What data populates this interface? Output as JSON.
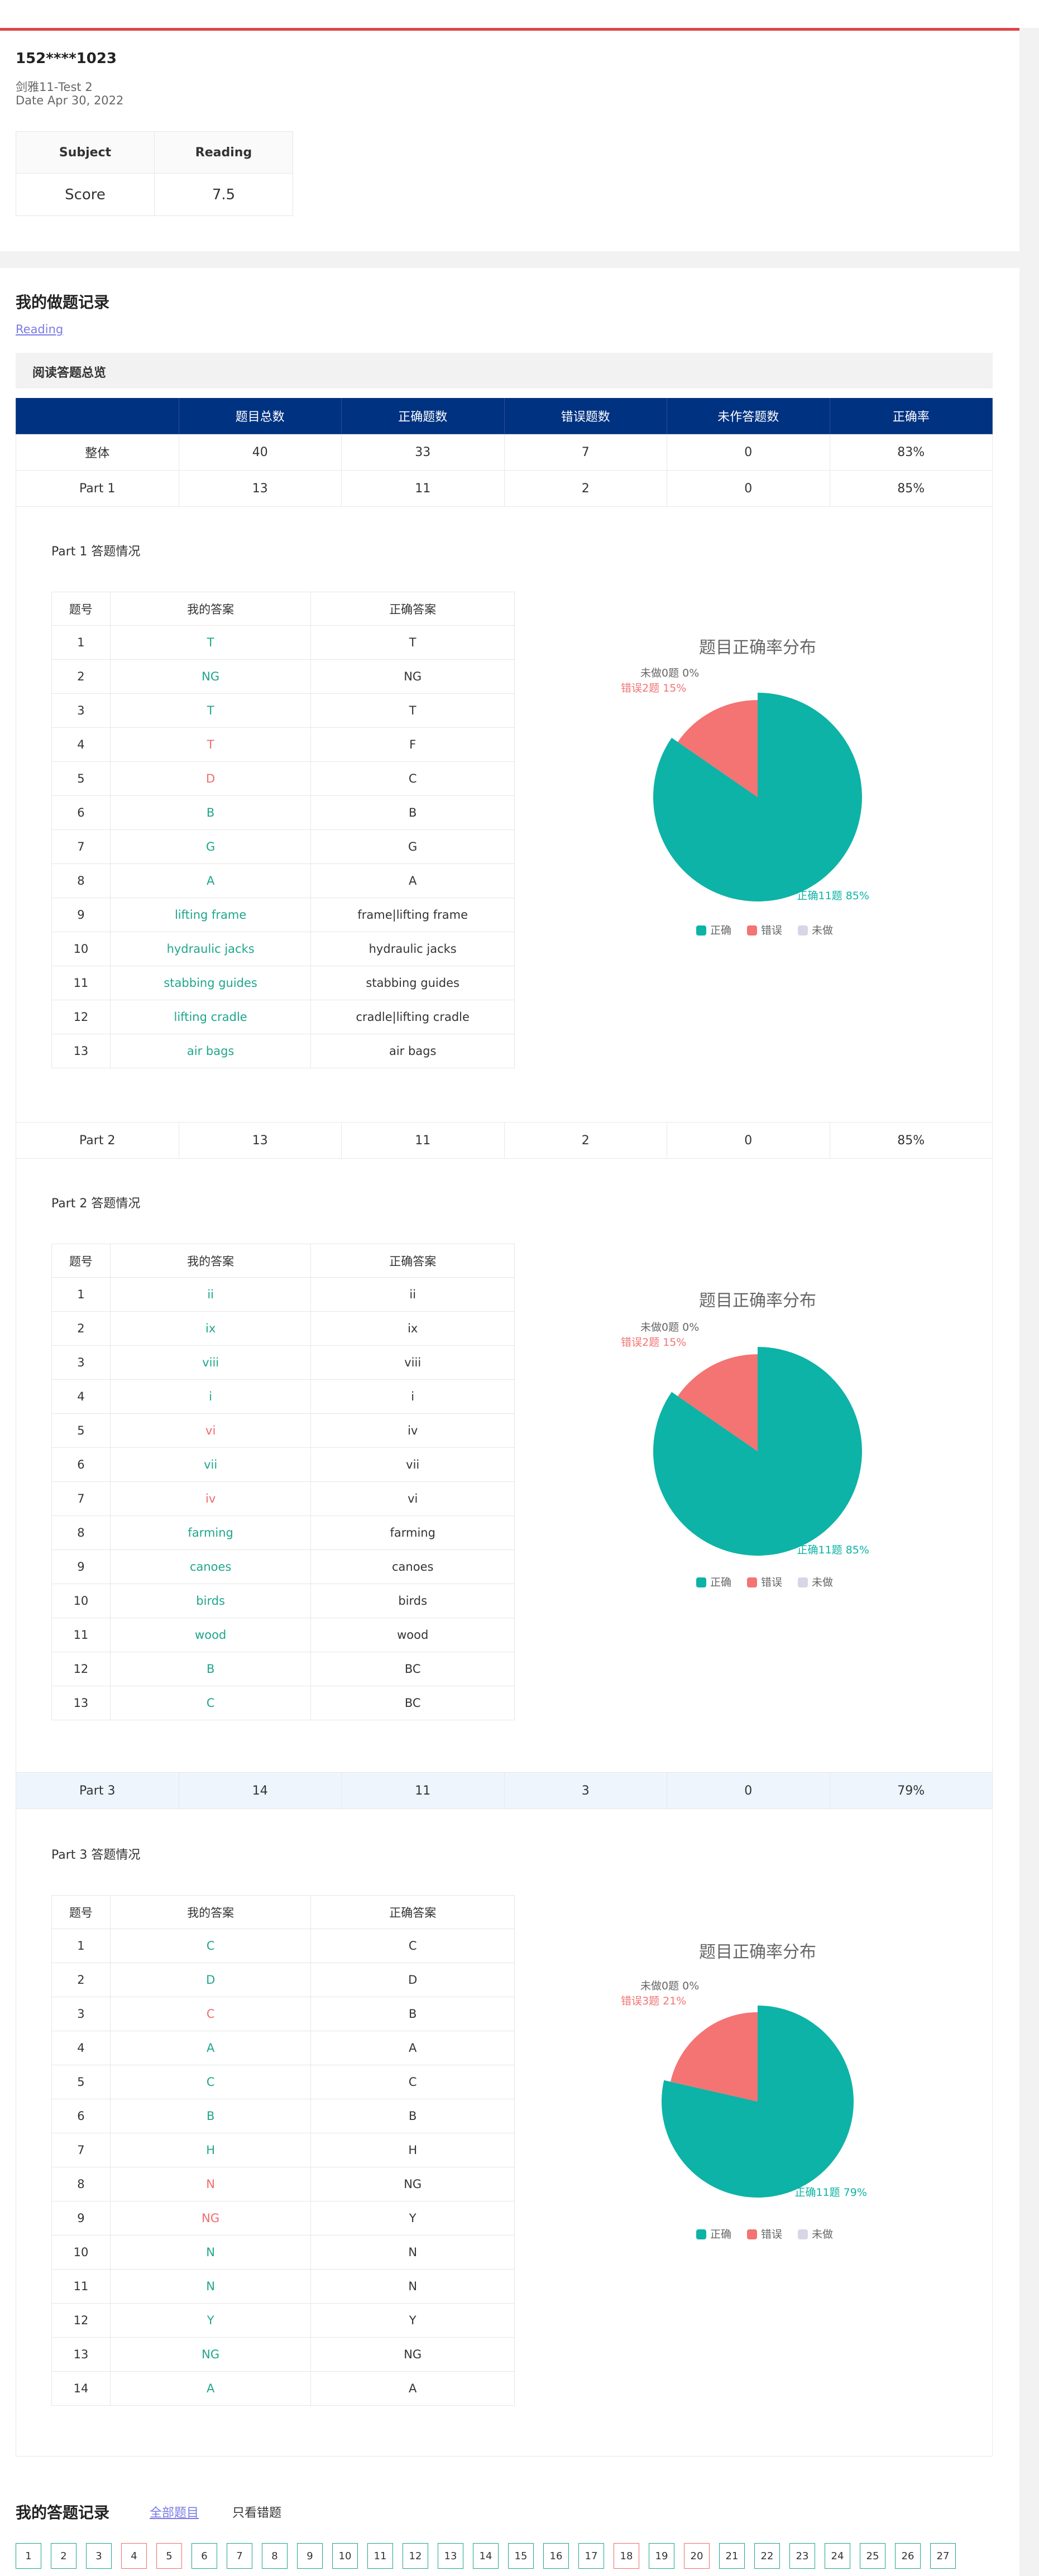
{
  "header": {
    "user": "152****1023",
    "test_name": "剑雅11-Test 2",
    "date": "Date Apr 30, 2022",
    "score_table": {
      "col1_header": "Subject",
      "col2_header": "Reading",
      "row_label": "Score",
      "score": "7.5"
    }
  },
  "records": {
    "title": "我的做题记录",
    "subject_link": "Reading",
    "overview_title": "阅读答题总览",
    "columns": [
      "",
      "题目总数",
      "正确题数",
      "错误题数",
      "未作答题数",
      "正确率"
    ],
    "overall": [
      "整体",
      "40",
      "33",
      "7",
      "0",
      "83%"
    ],
    "parts": [
      {
        "summary": [
          "Part 1",
          "13",
          "11",
          "2",
          "0",
          "85%"
        ],
        "detail_title": "Part 1 答题情况",
        "table_headers": [
          "题号",
          "我的答案",
          "正确答案"
        ],
        "rows": [
          {
            "no": "1",
            "mine": "T",
            "correct": "T",
            "ok": true
          },
          {
            "no": "2",
            "mine": "NG",
            "correct": "NG",
            "ok": true
          },
          {
            "no": "3",
            "mine": "T",
            "correct": "T",
            "ok": true
          },
          {
            "no": "4",
            "mine": "T",
            "correct": "F",
            "ok": false
          },
          {
            "no": "5",
            "mine": "D",
            "correct": "C",
            "ok": false
          },
          {
            "no": "6",
            "mine": "B",
            "correct": "B",
            "ok": true
          },
          {
            "no": "7",
            "mine": "G",
            "correct": "G",
            "ok": true
          },
          {
            "no": "8",
            "mine": "A",
            "correct": "A",
            "ok": true
          },
          {
            "no": "9",
            "mine": "lifting frame",
            "correct": "frame|lifting frame",
            "ok": true
          },
          {
            "no": "10",
            "mine": "hydraulic jacks",
            "correct": "hydraulic jacks",
            "ok": true
          },
          {
            "no": "11",
            "mine": "stabbing guides",
            "correct": "stabbing guides",
            "ok": true
          },
          {
            "no": "12",
            "mine": "lifting cradle",
            "correct": "cradle|lifting cradle",
            "ok": true
          },
          {
            "no": "13",
            "mine": "air bags",
            "correct": "air bags",
            "ok": true
          }
        ],
        "chart": {
          "title": "题目正确率分布",
          "label_correct": "正确11题  85%",
          "label_wrong": "错误2题  15%",
          "label_blank": "未做0题  0%"
        }
      },
      {
        "summary": [
          "Part 2",
          "13",
          "11",
          "2",
          "0",
          "85%"
        ],
        "detail_title": "Part 2 答题情况",
        "table_headers": [
          "题号",
          "我的答案",
          "正确答案"
        ],
        "rows": [
          {
            "no": "1",
            "mine": "ii",
            "correct": "ii",
            "ok": true
          },
          {
            "no": "2",
            "mine": "ix",
            "correct": "ix",
            "ok": true
          },
          {
            "no": "3",
            "mine": "viii",
            "correct": "viii",
            "ok": true
          },
          {
            "no": "4",
            "mine": "i",
            "correct": "i",
            "ok": true
          },
          {
            "no": "5",
            "mine": "vi",
            "correct": "iv",
            "ok": false
          },
          {
            "no": "6",
            "mine": "vii",
            "correct": "vii",
            "ok": true
          },
          {
            "no": "7",
            "mine": "iv",
            "correct": "vi",
            "ok": false
          },
          {
            "no": "8",
            "mine": "farming",
            "correct": "farming",
            "ok": true
          },
          {
            "no": "9",
            "mine": "canoes",
            "correct": "canoes",
            "ok": true
          },
          {
            "no": "10",
            "mine": "birds",
            "correct": "birds",
            "ok": true
          },
          {
            "no": "11",
            "mine": "wood",
            "correct": "wood",
            "ok": true
          },
          {
            "no": "12",
            "mine": "B",
            "correct": "BC",
            "ok": true
          },
          {
            "no": "13",
            "mine": "C",
            "correct": "BC",
            "ok": true
          }
        ],
        "chart": {
          "title": "题目正确率分布",
          "label_correct": "正确11题  85%",
          "label_wrong": "错误2题  15%",
          "label_blank": "未做0题  0%"
        }
      },
      {
        "summary": [
          "Part 3",
          "14",
          "11",
          "3",
          "0",
          "79%"
        ],
        "detail_title": "Part 3 答题情况",
        "table_headers": [
          "题号",
          "我的答案",
          "正确答案"
        ],
        "rows": [
          {
            "no": "1",
            "mine": "C",
            "correct": "C",
            "ok": true
          },
          {
            "no": "2",
            "mine": "D",
            "correct": "D",
            "ok": true
          },
          {
            "no": "3",
            "mine": "C",
            "correct": "B",
            "ok": false
          },
          {
            "no": "4",
            "mine": "A",
            "correct": "A",
            "ok": true
          },
          {
            "no": "5",
            "mine": "C",
            "correct": "C",
            "ok": true
          },
          {
            "no": "6",
            "mine": "B",
            "correct": "B",
            "ok": true
          },
          {
            "no": "7",
            "mine": "H",
            "correct": "H",
            "ok": true
          },
          {
            "no": "8",
            "mine": "N",
            "correct": "NG",
            "ok": false
          },
          {
            "no": "9",
            "mine": "NG",
            "correct": "Y",
            "ok": false
          },
          {
            "no": "10",
            "mine": "N",
            "correct": "N",
            "ok": true
          },
          {
            "no": "11",
            "mine": "N",
            "correct": "N",
            "ok": true
          },
          {
            "no": "12",
            "mine": "Y",
            "correct": "Y",
            "ok": true
          },
          {
            "no": "13",
            "mine": "NG",
            "correct": "NG",
            "ok": true
          },
          {
            "no": "14",
            "mine": "A",
            "correct": "A",
            "ok": true
          }
        ],
        "chart": {
          "title": "题目正确率分布",
          "label_correct": "正确11题  79%",
          "label_wrong": "错误3题  21%",
          "label_blank": "未做0题  0%"
        }
      }
    ],
    "legend": [
      "正确",
      "错误",
      "未做"
    ]
  },
  "chart_data": [
    {
      "type": "pie",
      "title": "题目正确率分布",
      "categories": [
        "正确",
        "错误",
        "未做"
      ],
      "values": [
        11,
        2,
        0
      ]
    },
    {
      "type": "pie",
      "title": "题目正确率分布",
      "categories": [
        "正确",
        "错误",
        "未做"
      ],
      "values": [
        11,
        2,
        0
      ]
    },
    {
      "type": "pie",
      "title": "题目正确率分布",
      "categories": [
        "正确",
        "错误",
        "未做"
      ],
      "values": [
        11,
        3,
        0
      ]
    }
  ],
  "answer_record": {
    "title": "我的答题记录",
    "tab_all": "全部题目",
    "tab_wrong": "只看错题",
    "numbers": [
      "1",
      "2",
      "3",
      "4",
      "5",
      "6",
      "7",
      "8",
      "9",
      "10",
      "11",
      "12",
      "13",
      "14",
      "15",
      "16",
      "17",
      "18",
      "19",
      "20",
      "21",
      "22",
      "23",
      "24",
      "25",
      "26",
      "27"
    ],
    "wrong_numbers": [
      "4",
      "5",
      "18",
      "20"
    ]
  },
  "colors": {
    "correct": "#0db3a6",
    "wrong": "#f47373",
    "blank": "#d6d6e6",
    "accent_red": "#e0454a",
    "header_blue": "#003282"
  }
}
